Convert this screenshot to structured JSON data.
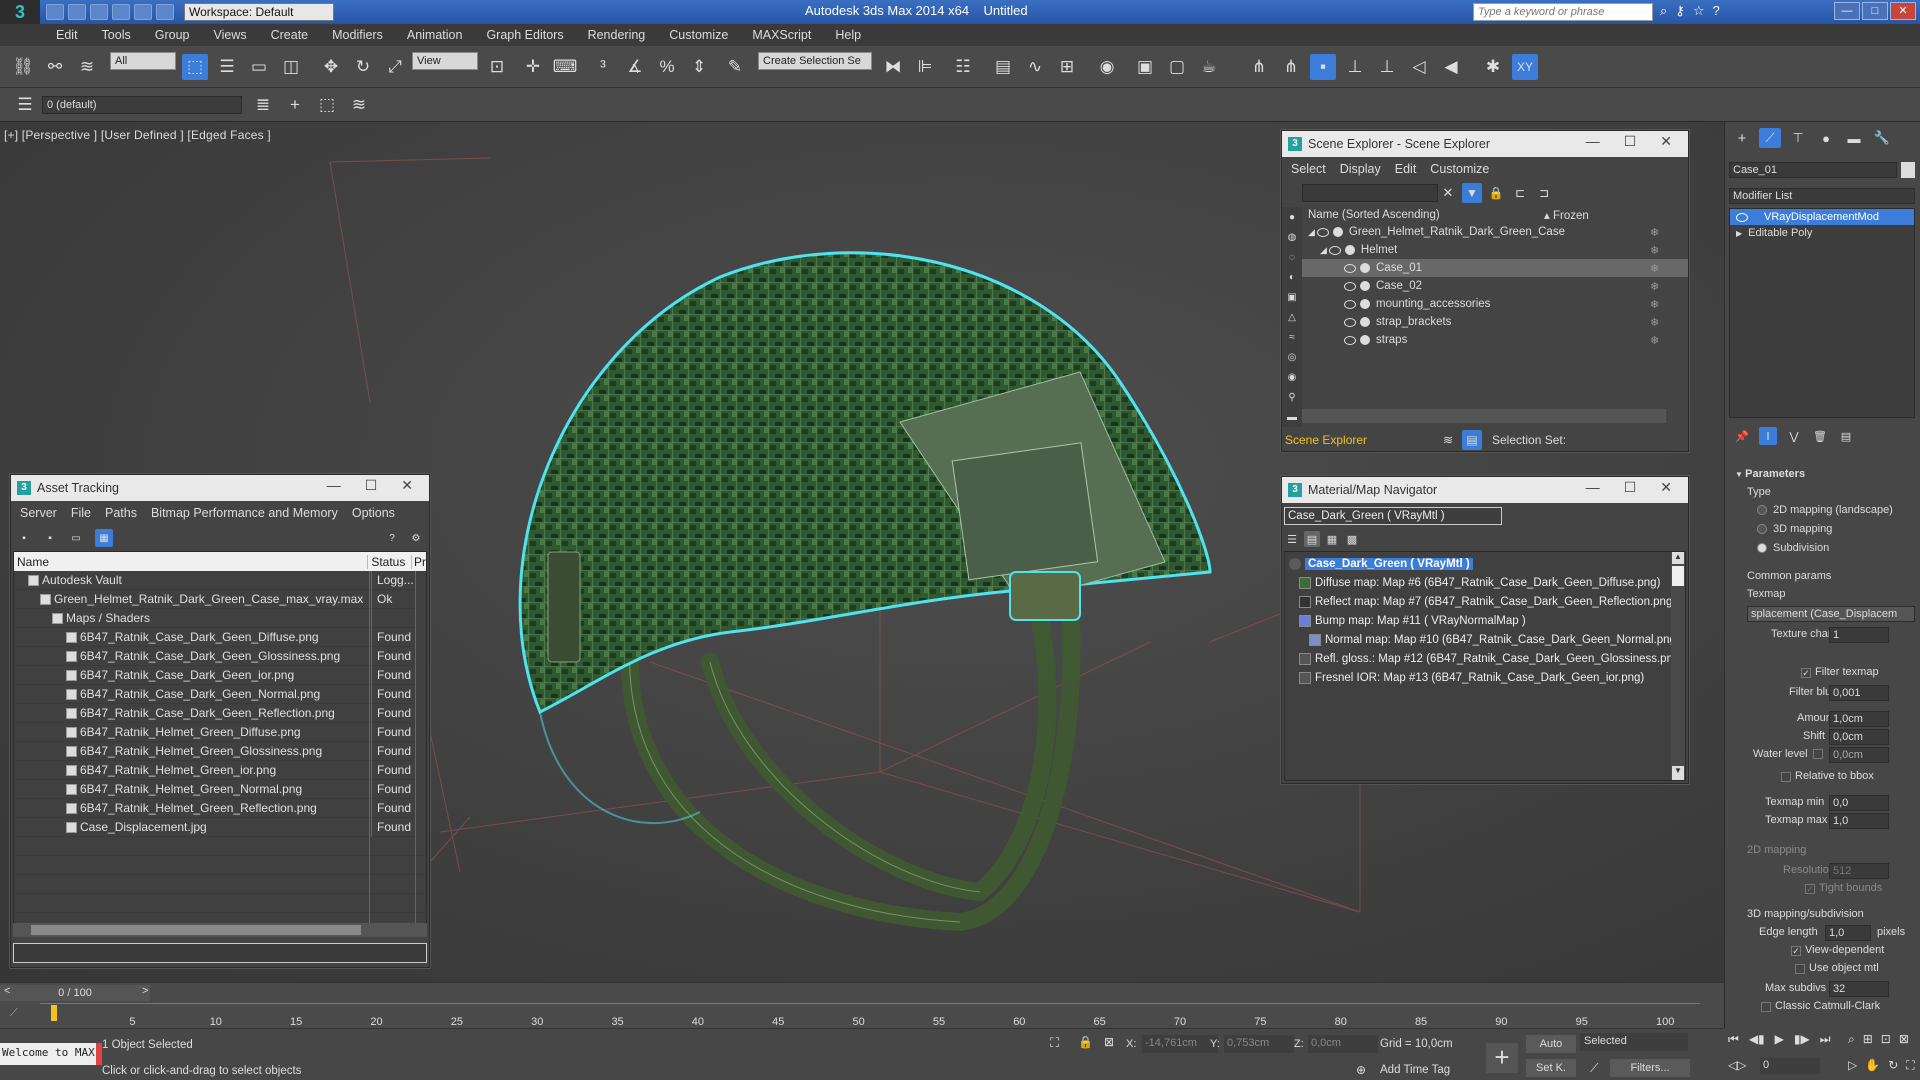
{
  "titlebar": {
    "logo": "3",
    "workspace": "Workspace: Default",
    "app_title": "Autodesk 3ds Max 2014 x64",
    "doc_title": "Untitled",
    "search_placeholder": "Type a keyword or phrase"
  },
  "menu": [
    "Edit",
    "Tools",
    "Group",
    "Views",
    "Create",
    "Modifiers",
    "Animation",
    "Graph Editors",
    "Rendering",
    "Customize",
    "MAXScript",
    "Help"
  ],
  "toolbar": {
    "selection_filter": "All",
    "ref_coord": "View",
    "named_selection": "Create Selection Se",
    "layer": "0 (default)"
  },
  "viewport": {
    "label": "[+] [Perspective ] [User Defined ] [Edged Faces ]"
  },
  "asset_tracking": {
    "title": "Asset Tracking",
    "menu": [
      "Server",
      "File",
      "Paths",
      "Bitmap Performance and Memory",
      "Options"
    ],
    "columns": [
      "Name",
      "Status",
      "Pr"
    ],
    "rows": [
      {
        "name": "Autodesk Vault",
        "status": "Logg..."
      },
      {
        "name": "Green_Helmet_Ratnik_Dark_Green_Case_max_vray.max",
        "status": "Ok"
      },
      {
        "name": "Maps / Shaders",
        "status": ""
      },
      {
        "name": "6B47_Ratnik_Case_Dark_Geen_Diffuse.png",
        "status": "Found"
      },
      {
        "name": "6B47_Ratnik_Case_Dark_Geen_Glossiness.png",
        "status": "Found"
      },
      {
        "name": "6B47_Ratnik_Case_Dark_Geen_ior.png",
        "status": "Found"
      },
      {
        "name": "6B47_Ratnik_Case_Dark_Geen_Normal.png",
        "status": "Found"
      },
      {
        "name": "6B47_Ratnik_Case_Dark_Geen_Reflection.png",
        "status": "Found"
      },
      {
        "name": "6B47_Ratnik_Helmet_Green_Diffuse.png",
        "status": "Found"
      },
      {
        "name": "6B47_Ratnik_Helmet_Green_Glossiness.png",
        "status": "Found"
      },
      {
        "name": "6B47_Ratnik_Helmet_Green_ior.png",
        "status": "Found"
      },
      {
        "name": "6B47_Ratnik_Helmet_Green_Normal.png",
        "status": "Found"
      },
      {
        "name": "6B47_Ratnik_Helmet_Green_Reflection.png",
        "status": "Found"
      },
      {
        "name": "Case_Displacement.jpg",
        "status": "Found"
      }
    ]
  },
  "scene_explorer": {
    "title": "Scene Explorer - Scene Explorer",
    "menu": [
      "Select",
      "Display",
      "Edit",
      "Customize"
    ],
    "col_name": "Name (Sorted Ascending)",
    "col_frozen": "▴ Frozen",
    "tree": [
      {
        "name": "Green_Helmet_Ratnik_Dark_Green_Case",
        "level": 0
      },
      {
        "name": "Helmet",
        "level": 1
      },
      {
        "name": "Case_01",
        "level": 2,
        "selected": true
      },
      {
        "name": "Case_02",
        "level": 2
      },
      {
        "name": "mounting_accessories",
        "level": 2
      },
      {
        "name": "strap_brackets",
        "level": 2
      },
      {
        "name": "straps",
        "level": 2
      }
    ],
    "footer_label": "Scene Explorer",
    "selection_set": "Selection Set:"
  },
  "material_nav": {
    "title": "Material/Map Navigator",
    "current": "Case_Dark_Green  ( VRayMtl )",
    "root": "Case_Dark_Green  ( VRayMtl )",
    "maps": [
      "Diffuse map: Map #6 (6B47_Ratnik_Case_Dark_Geen_Diffuse.png)",
      "Reflect map: Map #7 (6B47_Ratnik_Case_Dark_Geen_Reflection.png)",
      "Bump map: Map #11  ( VRayNormalMap )",
      "Normal map: Map #10 (6B47_Ratnik_Case_Dark_Geen_Normal.png)",
      "Refl. gloss.: Map #12 (6B47_Ratnik_Case_Dark_Geen_Glossiness.png)",
      "Fresnel IOR: Map #13 (6B47_Ratnik_Case_Dark_Geen_ior.png)"
    ]
  },
  "command_panel": {
    "object_name": "Case_01",
    "modifier_list": "Modifier List",
    "stack": [
      "VRayDisplacementMod",
      "Editable Poly"
    ],
    "parameters": "Parameters",
    "type_label": "Type",
    "type_options": [
      "2D mapping (landscape)",
      "3D mapping",
      "Subdivision"
    ],
    "common_params": "Common params",
    "texmap_label": "Texmap",
    "texmap_value": "splacement (Case_Displacem",
    "texture_chan": "Texture chan",
    "texture_chan_val": "1",
    "filter_texmap": "Filter texmap",
    "filter_blur": "Filter blur",
    "filter_blur_val": "0,001",
    "amount": "Amount",
    "amount_val": "1,0cm",
    "shift": "Shift",
    "shift_val": "0,0cm",
    "water_level": "Water level",
    "water_level_val": "0,0cm",
    "relative_bbox": "Relative to bbox",
    "texmap_min": "Texmap min",
    "texmap_min_val": "0,0",
    "texmap_max": "Texmap max",
    "texmap_max_val": "1,0",
    "map2d": "2D mapping",
    "resolution": "Resolution",
    "resolution_val": "512",
    "tight_bounds": "Tight bounds",
    "map3d": "3D mapping/subdivision",
    "edge_length": "Edge length",
    "edge_length_val": "1,0",
    "pixels": "pixels",
    "view_dependent": "View-dependent",
    "use_object_mtl": "Use object mtl",
    "max_subdivs": "Max subdivs",
    "max_subdivs_val": "32",
    "classic_catmull": "Classic Catmull-Clark"
  },
  "timeline": {
    "frame": "0 / 100",
    "ticks": [
      "0",
      "5",
      "10",
      "15",
      "20",
      "25",
      "30",
      "35",
      "40",
      "45",
      "50",
      "55",
      "60",
      "65",
      "70",
      "75",
      "80",
      "85",
      "90",
      "95",
      "100"
    ]
  },
  "status": {
    "maxscript": "Welcome to MAX",
    "selected": "1 Object Selected",
    "prompt": "Click or click-and-drag to select objects",
    "x_label": "X:",
    "x_val": "-14,761cm",
    "y_label": "Y:",
    "y_val": "0,753cm",
    "z_label": "Z:",
    "z_val": "0,0cm",
    "grid": "Grid = 10,0cm",
    "add_time_tag": "Add Time Tag",
    "auto": "Auto",
    "set_key": "Set K.",
    "key_filter": "Selected",
    "filters": "Filters...",
    "frame_field": "0"
  },
  "colors": {
    "accent": "#3c7dd9",
    "selection_outline": "#4fe3f0",
    "helmet_green": "#2f5a30"
  }
}
